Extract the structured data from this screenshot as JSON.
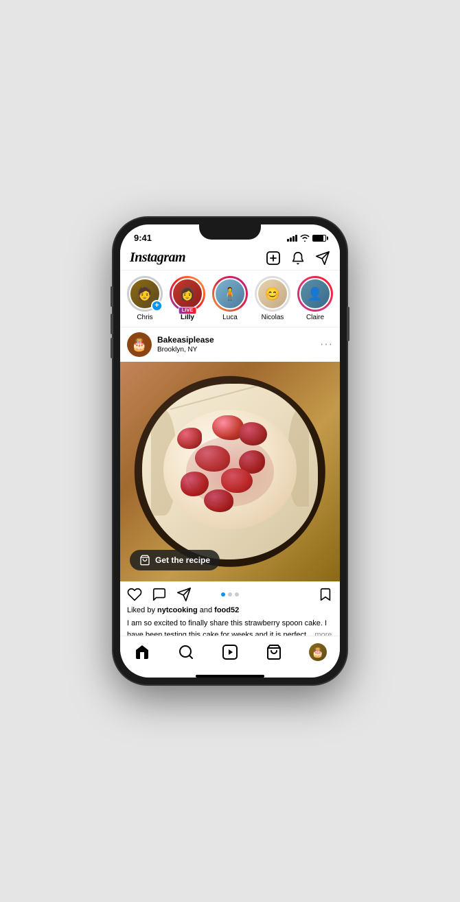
{
  "status": {
    "time": "9:41",
    "battery_level": "85"
  },
  "header": {
    "logo": "Instagram",
    "add_label": "Add",
    "heart_label": "Notifications",
    "send_label": "Direct Messages"
  },
  "stories": {
    "items": [
      {
        "id": "chris",
        "label": "Chris",
        "type": "add",
        "emoji": "🧑",
        "ring": "no-ring"
      },
      {
        "id": "lilly",
        "label": "Lilly",
        "type": "live",
        "emoji": "👩",
        "ring": "live-ring"
      },
      {
        "id": "luca",
        "label": "Luca",
        "type": "normal",
        "emoji": "🧍",
        "ring": "normal"
      },
      {
        "id": "nicolas",
        "label": "Nicolas",
        "type": "normal",
        "emoji": "😊",
        "ring": "normal"
      },
      {
        "id": "claire",
        "label": "Claire",
        "type": "normal",
        "emoji": "👤",
        "ring": "normal"
      }
    ]
  },
  "post": {
    "username": "Bakeasiplease",
    "location": "Brooklyn, NY",
    "liked_by": "Liked by ",
    "liker1": "nytcooking",
    "and": " and ",
    "liker2": "food52",
    "caption": "I am so excited to finally share this strawberry spoon cake.  I have been testing this cake for weeks and it is perfect...",
    "more": " more",
    "recipe_button": "Get the recipe",
    "dots": [
      true,
      false,
      false
    ],
    "indicator_count": 3,
    "active_dot": 0
  },
  "nav": {
    "home": "home",
    "search": "search",
    "reels": "reels",
    "shop": "shop",
    "profile": "profile"
  }
}
